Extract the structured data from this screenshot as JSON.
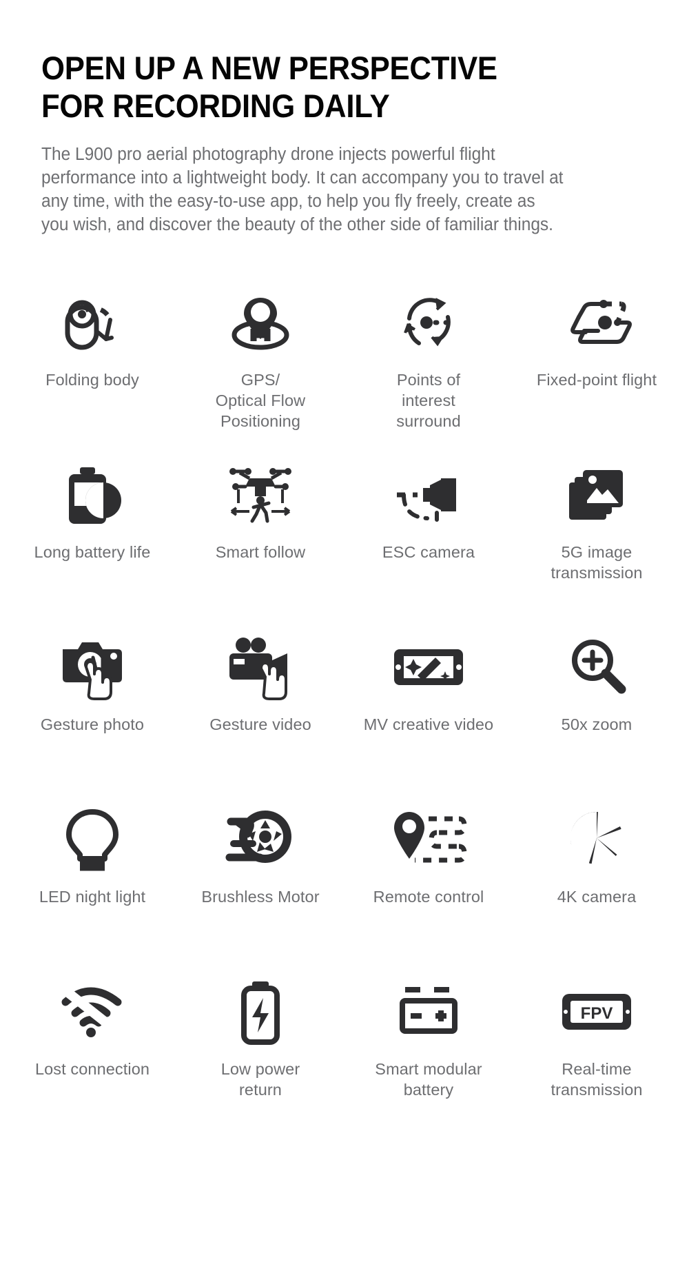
{
  "header": {
    "headline": "OPEN UP A NEW PERSPECTIVE\nFOR RECORDING DAILY",
    "subcopy": "The L900 pro aerial photography drone injects powerful flight performance into a lightweight body. It can accompany you to travel at any time, with the easy-to-use app, to help you fly freely, create as you wish, and discover the beauty of the other side of familiar things."
  },
  "colors": {
    "headline": "#050505",
    "body_text": "#6d6e71",
    "icon": "#2e2e30",
    "background": "#ffffff"
  },
  "features": [
    {
      "label": "Folding body",
      "icon": "folding-body-icon"
    },
    {
      "label": "GPS/\nOptical Flow\nPositioning",
      "icon": "gps-optical-flow-icon"
    },
    {
      "label": "Points of\ninterest\nsurround",
      "icon": "points-of-interest-surround-icon"
    },
    {
      "label": "Fixed-point flight",
      "icon": "fixed-point-flight-icon"
    },
    {
      "label": "Long battery life",
      "icon": "battery-life-icon"
    },
    {
      "label": "Smart follow",
      "icon": "smart-follow-icon"
    },
    {
      "label": "ESC camera",
      "icon": "esc-camera-icon"
    },
    {
      "label": "5G image\ntransmission",
      "icon": "image-transmission-icon"
    },
    {
      "label": "Gesture photo",
      "icon": "gesture-photo-icon"
    },
    {
      "label": "Gesture video",
      "icon": "gesture-video-icon"
    },
    {
      "label": "MV creative video",
      "icon": "mv-creative-video-icon"
    },
    {
      "label": "50x zoom",
      "icon": "zoom-in-icon"
    },
    {
      "label": "LED night light",
      "icon": "led-light-bulb-icon"
    },
    {
      "label": "Brushless Motor",
      "icon": "brushless-motor-icon"
    },
    {
      "label": "Remote control",
      "icon": "remote-control-route-icon"
    },
    {
      "label": "4K camera",
      "icon": "camera-shutter-icon"
    },
    {
      "label": "Lost connection",
      "icon": "lost-connection-wifi-icon"
    },
    {
      "label": "Low power\nreturn",
      "icon": "low-power-battery-icon"
    },
    {
      "label": "Smart modular\nbattery",
      "icon": "modular-battery-icon"
    },
    {
      "label": "Real-time\ntransmission",
      "icon": "fpv-screen-icon"
    }
  ],
  "fpv_label": "FPV"
}
